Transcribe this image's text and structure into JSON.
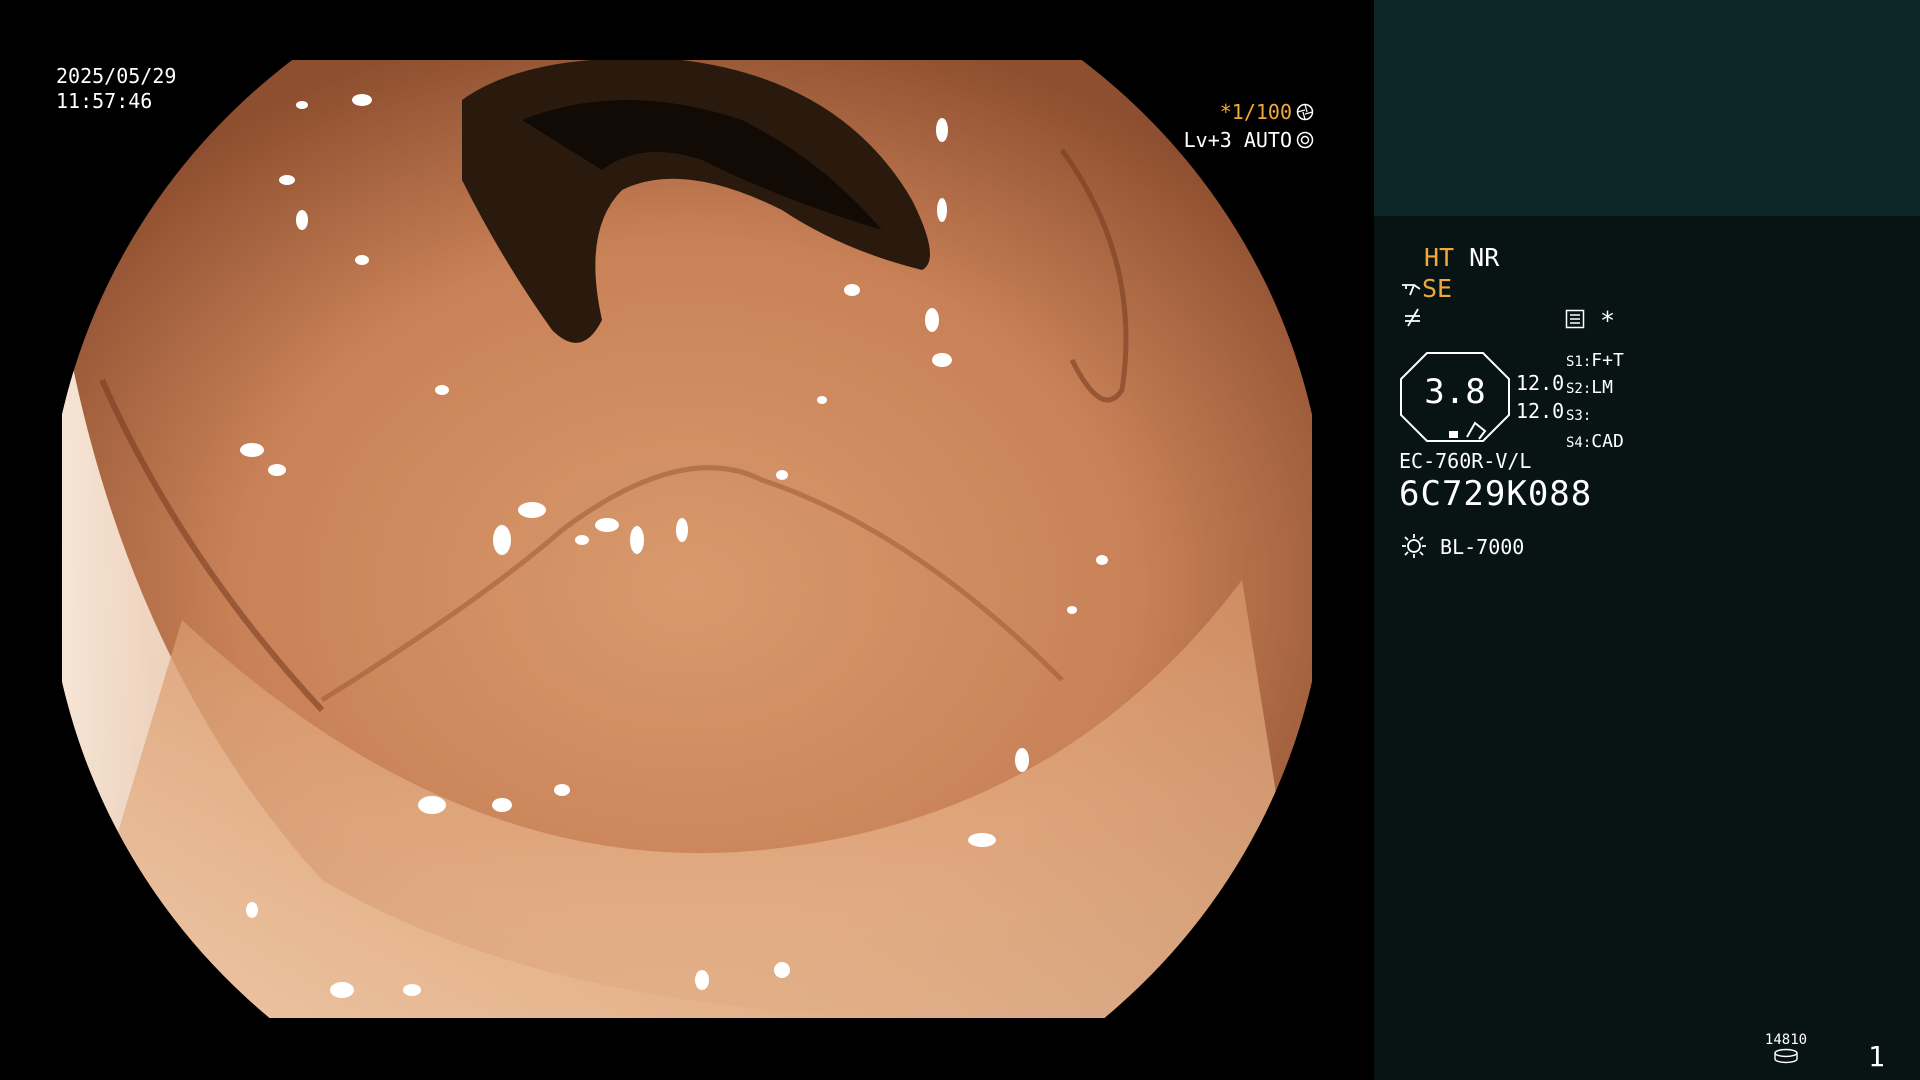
{
  "timestamp": {
    "date": "2025/05/29",
    "time": "11:57:46"
  },
  "exposure": {
    "shutter": "*1/100",
    "shutter_icon": "aperture-icon",
    "level": "Lv+3 AUTO",
    "level_icon": "auto-iris-icon"
  },
  "image": {
    "subject": "endoscopic-colon-view",
    "tissue_color": "#c98a5c"
  },
  "panel": {
    "mode_ht": "HT",
    "mode_nr": "NR",
    "mode_se": "SE",
    "icons": {
      "scope": "scope-tip-icon",
      "freeze": "freeze-icon",
      "menu": "menu-icon",
      "asterisk": "asterisk-icon"
    },
    "asterisk": "*",
    "zoom_value": "3.8",
    "values": [
      "12.0",
      "12.0"
    ],
    "switches": [
      {
        "key": "S1",
        "value": "F+T"
      },
      {
        "key": "S2",
        "value": "LM"
      },
      {
        "key": "S3",
        "value": ""
      },
      {
        "key": "S4",
        "value": "CAD"
      }
    ],
    "scope_model": "EC-760R-V/L",
    "scope_serial": "6C729K088",
    "light_source": "BL-7000",
    "counter": "14810",
    "page": "1"
  },
  "colors": {
    "accent": "#f2a93b",
    "panel_bg": "#081414",
    "panel_top": "#0d2628"
  }
}
